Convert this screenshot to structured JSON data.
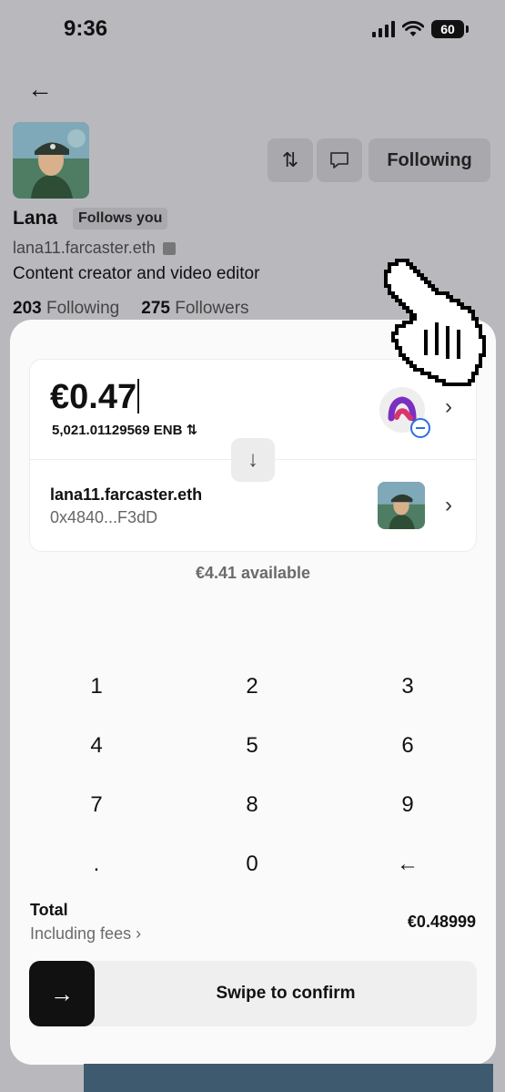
{
  "status_bar": {
    "time": "9:36",
    "battery": "60"
  },
  "profile": {
    "name": "Lana",
    "follows_badge": "Follows you",
    "handle": "lana11.farcaster.eth",
    "bio": "Content creator and video editor",
    "following_count": "203",
    "following_label": "Following",
    "followers_count": "275",
    "followers_label": "Followers",
    "following_button": "Following"
  },
  "payment": {
    "amount": "€0.47",
    "token_amount": "5,021.01129569 ENB ⇅",
    "recipient_name": "lana11.farcaster.eth",
    "recipient_address": "0x4840...F3dD",
    "available": "€4.41 available"
  },
  "keypad": [
    "1",
    "2",
    "3",
    "4",
    "5",
    "6",
    "7",
    "8",
    "9",
    ".",
    "0",
    "←"
  ],
  "total": {
    "label": "Total",
    "fees_label": "Including fees ›",
    "value": "€0.48999"
  },
  "swipe": {
    "label": "Swipe to confirm"
  },
  "icons": {
    "back": "arrow-left-icon",
    "swap": "swap-icon",
    "message": "message-icon",
    "chevron": "chevron-right-icon",
    "down": "arrow-down-icon",
    "confirm": "arrow-right-icon"
  },
  "colors": {
    "accent": "#111111",
    "overlay": "#b9b9bd",
    "sheet": "#fafafa",
    "link_blue": "#2f6de0"
  }
}
